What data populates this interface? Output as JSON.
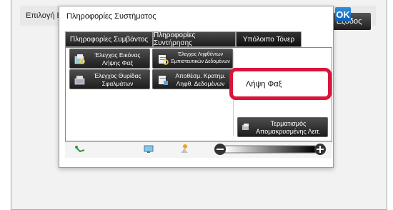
{
  "background": {
    "title": "Επιλογή Εξ",
    "exit_label": "Έξοδος"
  },
  "dialog": {
    "title": "Πληροφορίες Συστήματος",
    "ok_label": "OK",
    "tabs": [
      {
        "label": "Πληροφορίες Συμβάντος"
      },
      {
        "label": "Πληροφορίες Συντήρησης"
      },
      {
        "label": "Υπόλοιπο Τόνερ"
      }
    ],
    "buttons": {
      "image_check": "Έλεγχος Εικόνας Λήψης Φαξ",
      "received_data_check": "Έλεγχος Ληφθέντων Εμπιστευτικών Δεδομένων",
      "error_tray_check": "Έλεγχος Θυρίδας Σφαλμάτων",
      "save_received_data": "Αποθέσμ. Κρατημ. Ληφθ. Δεδομένων",
      "fax_reception": "Λήψη Φαξ",
      "remote_end": "Τερματισμός Απομακρυσμένης Λειτ."
    }
  },
  "status_bar": {
    "icons": [
      "network-icon",
      "screen-icon",
      "job-status-icon"
    ],
    "contrast": {
      "level": 1.0
    }
  },
  "colors": {
    "highlight": "#d9163a",
    "ok_button": "#1f7bd1",
    "button_dark": "#1d1d1d"
  }
}
